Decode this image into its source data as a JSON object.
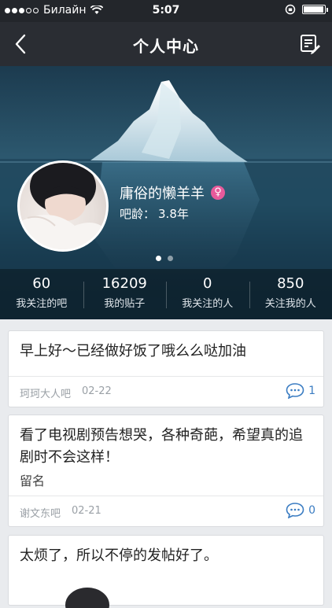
{
  "status_bar": {
    "carrier": "Билайн",
    "time": "5:07",
    "battery_level": 0.95
  },
  "nav": {
    "title": "个人中心",
    "back_icon": "chevron-left-icon",
    "edit_icon": "edit-note-icon"
  },
  "profile": {
    "username": "庸俗的懒羊羊",
    "gender_symbol": "♀",
    "bar_age_label": "吧龄：",
    "bar_age_value": "3.8年"
  },
  "stats": [
    {
      "value": "60",
      "label": "我关注的吧"
    },
    {
      "value": "16209",
      "label": "我的贴子"
    },
    {
      "value": "0",
      "label": "我关注的人"
    },
    {
      "value": "850",
      "label": "关注我的人"
    }
  ],
  "posts": [
    {
      "content": "早上好～已经做好饭了哦么么哒加油",
      "extra": "",
      "bar": "珂珂大人吧",
      "date": "02-22",
      "comments": "1"
    },
    {
      "content": "看了电视剧预告想哭，各种奇葩，希望真的追剧时不会这样！",
      "extra": "留名",
      "bar": "谢文东吧",
      "date": "02-21",
      "comments": "0"
    },
    {
      "content": "太烦了，所以不停的发帖好了。",
      "extra": "",
      "bar": "",
      "date": "",
      "comments": ""
    }
  ],
  "colors": {
    "navbar": "#2a2d33",
    "accent_blue": "#3a7cc2",
    "female_pink": "#e85a9b"
  }
}
